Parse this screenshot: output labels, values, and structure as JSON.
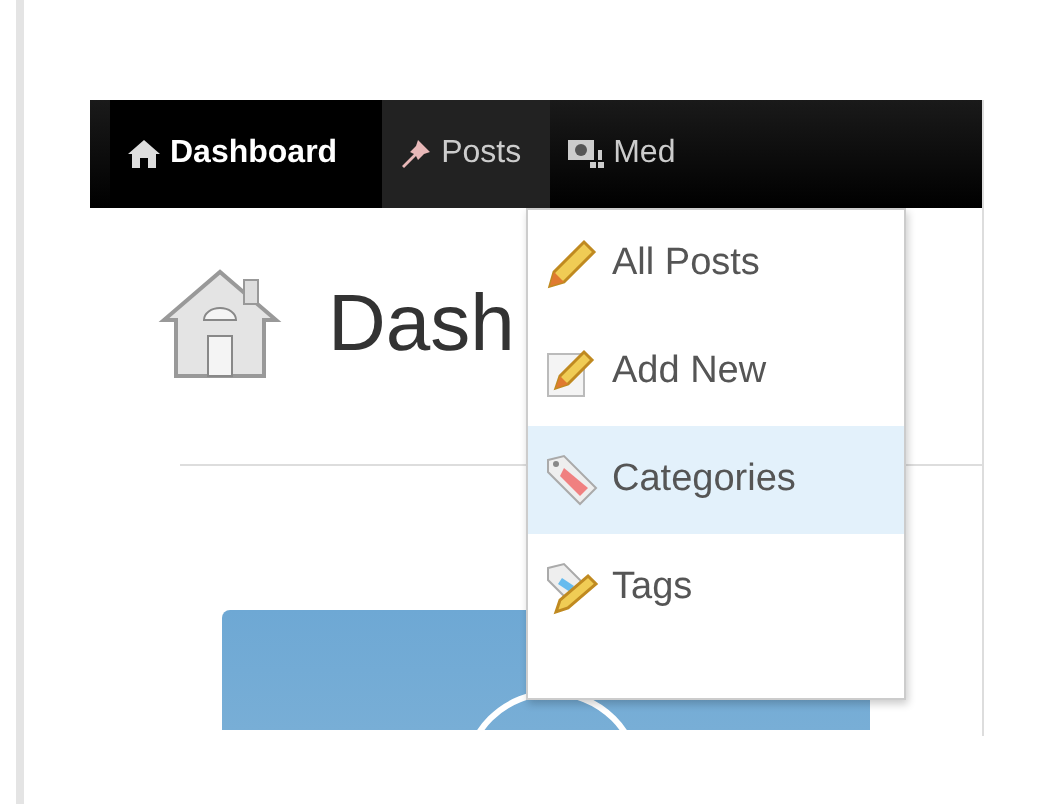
{
  "nav": [
    {
      "label": "Dashboard",
      "selected": true,
      "expanded": false
    },
    {
      "label": "Posts",
      "selected": false,
      "expanded": true
    },
    {
      "label": "Med",
      "selected": false,
      "expanded": false
    }
  ],
  "posts_menu": [
    {
      "label": "All Posts",
      "selected": false
    },
    {
      "label": "Add New",
      "selected": false
    },
    {
      "label": "Categories",
      "selected": true
    },
    {
      "label": "Tags",
      "selected": false
    }
  ],
  "page_title": "Dash"
}
